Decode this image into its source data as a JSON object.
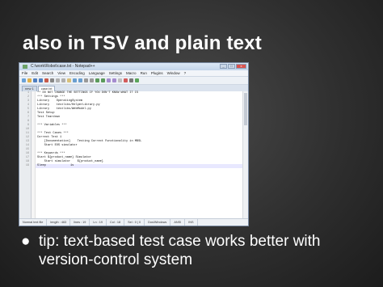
{
  "slide": {
    "title": "also in TSV and plain text",
    "bullet_symbol": "●",
    "bullet_text": "tip: text-based test case works better with version-control system"
  },
  "window": {
    "title": "C:\\work\\Robot\\case.txt - Notepad++",
    "buttons": [
      "_",
      "□",
      "x"
    ],
    "menu": [
      "File",
      "Edit",
      "Search",
      "View",
      "Encoding",
      "Language",
      "Settings",
      "Macro",
      "Run",
      "Plugins",
      "Window",
      "?"
    ],
    "tabs": [
      "new 1",
      "case.txt"
    ],
    "active_tab": 1
  },
  "editor": {
    "lines": [
      "** DO NOT CHANGE THE SETTINGS IF YOU DON'T KNOW WHAT IT IS",
      "*** Settings ***",
      "Library    OperatingSystem",
      "Library    testlibs/HelperLibrary.py",
      "Library    testlibs/WebModel.py",
      "Test Setup",
      "Test Teardown",
      "",
      "*** Variables ***",
      "",
      "*** Test Cases ***",
      "Correct Test 1",
      "    [Documentation]    Testing Correct Functionality in MBSL",
      "    Start EOS simulator",
      "",
      "*** Keywords ***",
      "Start ${product_name} Simulator",
      "    Start simulator    ${product_name}",
      "Sleep              1s"
    ],
    "current_line": 19
  },
  "status": {
    "file_type": "Normal text file",
    "length": "length : 463",
    "lines": "lines : 19",
    "ln": "Ln : 19",
    "col": "Col : 18",
    "sel": "Sel : 0 | 0",
    "eol": "Dos\\Windows",
    "encoding": "ANSI",
    "mode": "INS"
  }
}
